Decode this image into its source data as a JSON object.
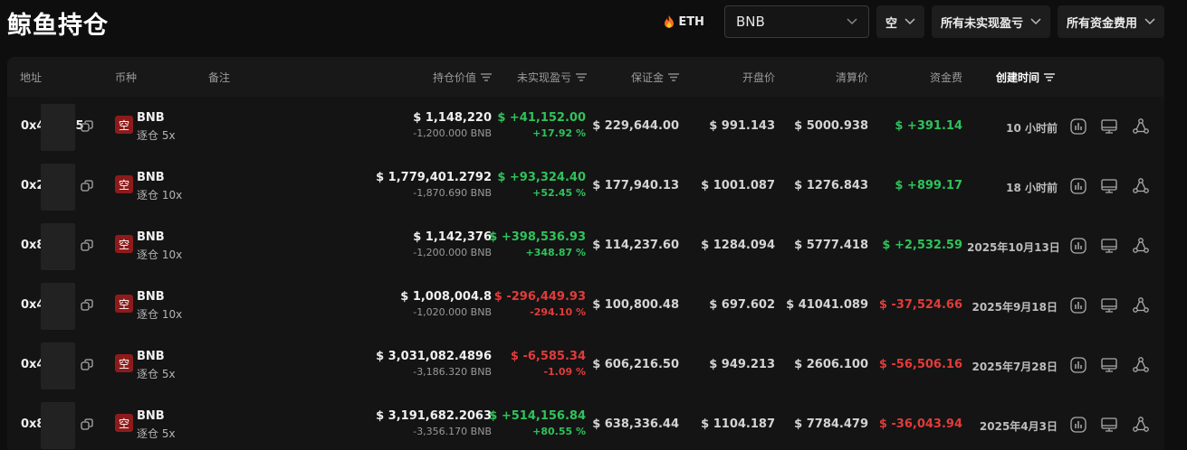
{
  "page": {
    "title": "鲸鱼持仓"
  },
  "filters": {
    "eth_tag": "ETH",
    "symbol": "BNB",
    "side": "空",
    "pnl": "所有未实现盈亏",
    "funding": "所有资金费用"
  },
  "columns": {
    "address": "地址",
    "coin": "币种",
    "note": "备注",
    "position_value": "持仓价值",
    "unrealized_pnl": "未实现盈亏",
    "margin": "保证金",
    "entry_price": "开盘价",
    "liq_price": "清算价",
    "funding": "资金费",
    "created": "创建时间"
  },
  "colors": {
    "positive": "#2fc25b",
    "negative": "#e23b3b",
    "short_badge": "#8e1b1b"
  },
  "rows": [
    {
      "addr": "0x4",
      "addr_tail": "5",
      "side": "空",
      "symbol": "BNB",
      "leverage": "逐仓 5x",
      "value": "$ 1,148,220",
      "size": "-1,200.000 BNB",
      "pnl": "$ +41,152.00",
      "pnl_pct": "+17.92 %",
      "pnl_dir": "pos",
      "margin": "$ 229,644.00",
      "entry": "$ 991.143",
      "liq": "$ 5000.938",
      "funding": "$ +391.14",
      "funding_dir": "pos",
      "time": "10 小时前"
    },
    {
      "addr": "0x2",
      "addr_tail": "",
      "side": "空",
      "symbol": "BNB",
      "leverage": "逐仓 10x",
      "value": "$ 1,779,401.2792",
      "size": "-1,870.690 BNB",
      "pnl": "$ +93,324.40",
      "pnl_pct": "+52.45 %",
      "pnl_dir": "pos",
      "margin": "$ 177,940.13",
      "entry": "$ 1001.087",
      "liq": "$ 1276.843",
      "funding": "$ +899.17",
      "funding_dir": "pos",
      "time": "18 小时前"
    },
    {
      "addr": "0x8",
      "addr_tail": "",
      "side": "空",
      "symbol": "BNB",
      "leverage": "逐仓 10x",
      "value": "$ 1,142,376",
      "size": "-1,200.000 BNB",
      "pnl": "$ +398,536.93",
      "pnl_pct": "+348.87 %",
      "pnl_dir": "pos",
      "margin": "$ 114,237.60",
      "entry": "$ 1284.094",
      "liq": "$ 5777.418",
      "funding": "$ +2,532.59",
      "funding_dir": "pos",
      "time": "2025年10月13日"
    },
    {
      "addr": "0x4",
      "addr_tail": "",
      "side": "空",
      "symbol": "BNB",
      "leverage": "逐仓 10x",
      "value": "$ 1,008,004.8",
      "size": "-1,020.000 BNB",
      "pnl": "$ -296,449.93",
      "pnl_pct": "-294.10 %",
      "pnl_dir": "neg",
      "margin": "$ 100,800.48",
      "entry": "$ 697.602",
      "liq": "$ 41041.089",
      "funding": "$ -37,524.66",
      "funding_dir": "neg",
      "time": "2025年9月18日"
    },
    {
      "addr": "0x4",
      "addr_tail": "",
      "side": "空",
      "symbol": "BNB",
      "leverage": "逐仓 5x",
      "value": "$ 3,031,082.4896",
      "size": "-3,186.320 BNB",
      "pnl": "$ -6,585.34",
      "pnl_pct": "-1.09 %",
      "pnl_dir": "neg",
      "margin": "$ 606,216.50",
      "entry": "$ 949.213",
      "liq": "$ 2606.100",
      "funding": "$ -56,506.16",
      "funding_dir": "neg",
      "time": "2025年7月28日"
    },
    {
      "addr": "0x8",
      "addr_tail": "",
      "side": "空",
      "symbol": "BNB",
      "leverage": "逐仓 5x",
      "value": "$ 3,191,682.2063",
      "size": "-3,356.170 BNB",
      "pnl": "$ +514,156.84",
      "pnl_pct": "+80.55 %",
      "pnl_dir": "pos",
      "margin": "$ 638,336.44",
      "entry": "$ 1104.187",
      "liq": "$ 7784.479",
      "funding": "$ -36,043.94",
      "funding_dir": "neg",
      "time": "2025年4月3日"
    }
  ]
}
